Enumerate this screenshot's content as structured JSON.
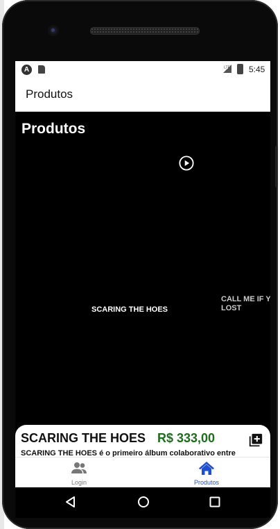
{
  "status_bar": {
    "time": "5:45",
    "launcher_glyph": "A"
  },
  "app_bar": {
    "title": "Produtos"
  },
  "page": {
    "heading": "Produtos"
  },
  "carousel": {
    "items": [
      {
        "title": "SCARING THE HOES"
      },
      {
        "title": "CALL ME IF YO",
        "title_line2": "LOST"
      }
    ]
  },
  "product_sheet": {
    "name": "SCARING THE HOES",
    "price": "R$ 333,00",
    "description": "SCARING THE HOES é o primeiro álbum colaborativo entre"
  },
  "tabs": [
    {
      "label": "Login",
      "icon": "users-icon",
      "active": false
    },
    {
      "label": "Produtos",
      "icon": "home-icon",
      "active": true
    }
  ],
  "colors": {
    "active_tab": "#1f4fd1",
    "inactive_tab": "#777777",
    "price": "#1b6e1b"
  }
}
